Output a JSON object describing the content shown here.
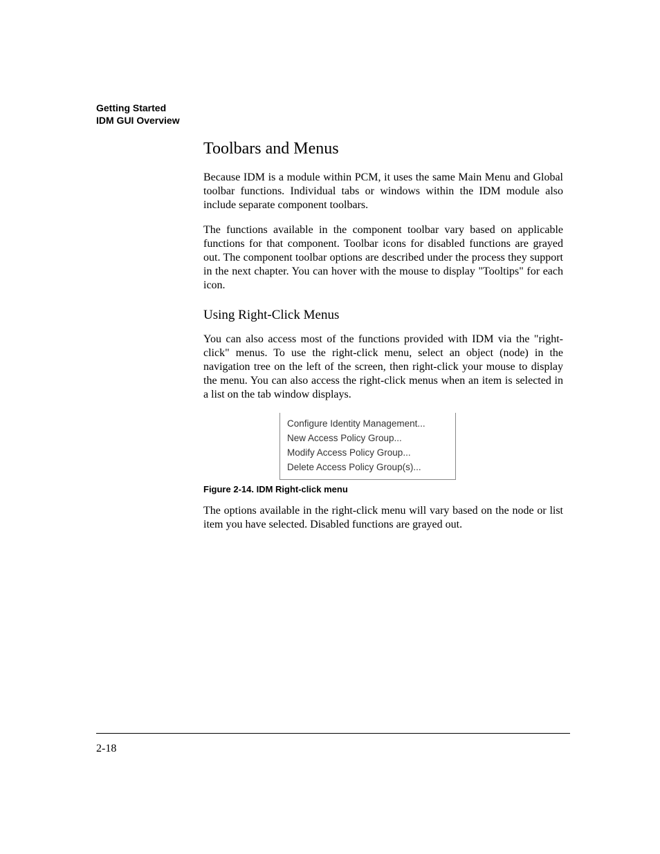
{
  "header": {
    "line1": "Getting Started",
    "line2": "IDM GUI Overview"
  },
  "section": {
    "title": "Toolbars and Menus",
    "para1": "Because IDM is a module within PCM, it uses the same Main Menu and Global toolbar functions. Individual tabs or windows within the IDM module also include separate component toolbars.",
    "para2": "The functions available in the component toolbar vary based on applicable functions for that component. Toolbar icons for disabled functions are grayed out. The component toolbar options are described under the process they support in the next chapter. You can hover with the mouse to display \"Tooltips\" for each icon.",
    "subheading": "Using Right-Click Menus",
    "para3": "You can also access most of the functions provided with IDM via the \"right-click\" menus. To use the right-click menu, select an object (node) in the navigation tree on the left of the screen, then right-click your mouse to display the menu. You can also access the right-click menus when an item is selected in a list on the tab window displays.",
    "para4": "The options available in the right-click menu will vary based on the node or list item you have selected. Disabled functions are grayed out."
  },
  "context_menu": {
    "items": [
      "Configure Identity Management...",
      "New Access Policy Group...",
      "Modify Access Policy Group...",
      "Delete Access Policy Group(s)..."
    ]
  },
  "figure_caption": "Figure 2-14. IDM Right-click menu",
  "page_number": "2-18"
}
